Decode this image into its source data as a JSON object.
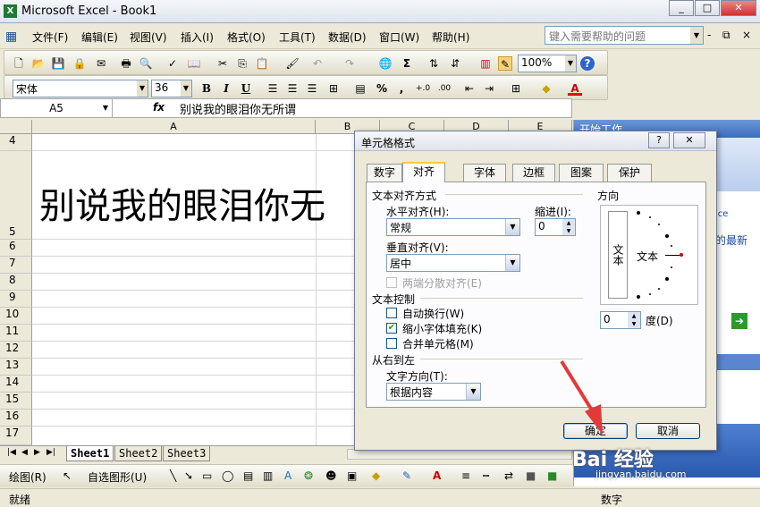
{
  "window": {
    "title": "Microsoft Excel - Book1",
    "min": "_",
    "max": "□",
    "close": "✕"
  },
  "menu": {
    "items": [
      "文件(F)",
      "编辑(E)",
      "视图(V)",
      "插入(I)",
      "格式(O)",
      "工具(T)",
      "数据(D)",
      "窗口(W)",
      "帮助(H)"
    ],
    "help_placeholder": "键入需要帮助的问题",
    "doc_controls": [
      "-",
      "⧉",
      "×"
    ]
  },
  "standard_toolbar": {
    "zoom": "100%",
    "sum_icon": "Σ",
    "help_icon": "?"
  },
  "format_toolbar": {
    "font": "宋体",
    "size": "36",
    "bold": "B",
    "italic": "I",
    "underline": "U",
    "percent": "%",
    "comma": ","
  },
  "formula_bar": {
    "cell_ref": "A5",
    "fx": "fx",
    "value": "别说我的眼泪你无所谓"
  },
  "sheet": {
    "columns": [
      "A",
      "B",
      "C",
      "D",
      "E"
    ],
    "rows": [
      "4",
      "5",
      "6",
      "7",
      "8",
      "9",
      "10",
      "11",
      "12",
      "13",
      "14",
      "15",
      "16",
      "17"
    ],
    "cell_a5": "别说我的眼泪你无"
  },
  "sheet_tabs": [
    "Sheet1",
    "Sheet2",
    "Sheet3"
  ],
  "draw_toolbar": {
    "draw": "绘图(R)",
    "autoshapes": "自选图形(U)"
  },
  "status": {
    "ready": "就绪",
    "num": "数字"
  },
  "task_pane": {
    "title": "开始工作",
    "text1": "ice",
    "text2": "的最新"
  },
  "dialog": {
    "title": "单元格格式",
    "help": "?",
    "close": "✕",
    "tabs": [
      "数字",
      "对齐",
      "字体",
      "边框",
      "图案",
      "保护"
    ],
    "active_tab": "对齐",
    "text_align_group": "文本对齐方式",
    "horizontal_label": "水平对齐(H):",
    "horizontal_value": "常规",
    "indent_label": "缩进(I):",
    "indent_value": "0",
    "vertical_label": "垂直对齐(V):",
    "vertical_value": "居中",
    "justify_distributed": "两端分散对齐(E)",
    "text_control_group": "文本控制",
    "wrap_text": "自动换行(W)",
    "shrink_to_fit": "缩小字体填充(K)",
    "merge_cells": "合并单元格(M)",
    "rtl_group": "从右到左",
    "text_direction_label": "文字方向(T):",
    "text_direction_value": "根据内容",
    "orientation_group": "方向",
    "vertical_text": "文本",
    "dial_text": "文本",
    "degree_value": "0",
    "degree_label": "度(D)",
    "ok": "确定",
    "cancel": "取消"
  },
  "watermark": {
    "brand": "Bai 经验",
    "url": "jingyan.baidu.com"
  }
}
